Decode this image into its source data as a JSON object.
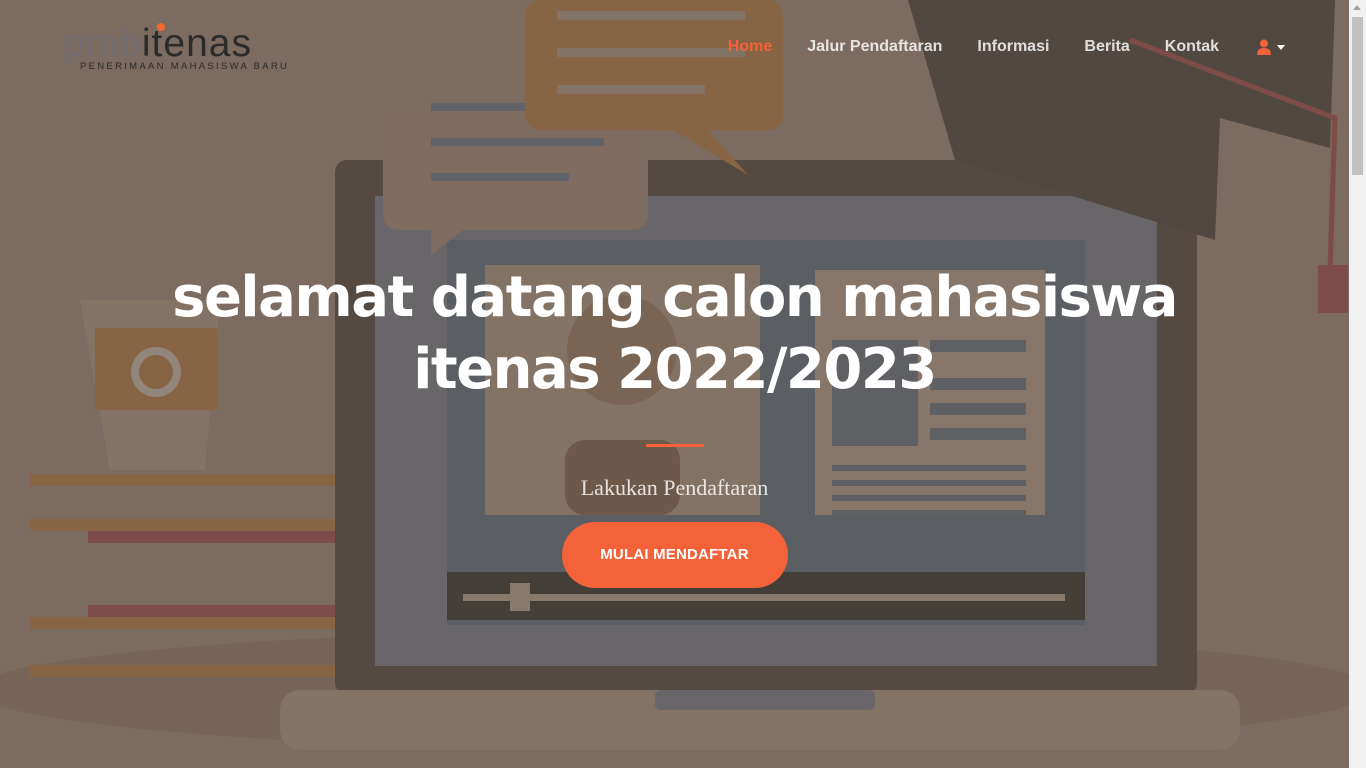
{
  "colors": {
    "accent": "#f4623a",
    "logo_dot": "#f26b2b",
    "overlay": "#7b6a60"
  },
  "logo": {
    "pmb": "pmb",
    "itenas": "itenas",
    "tagline": "PENERIMAAN MAHASISWA BARU"
  },
  "nav": {
    "items": [
      {
        "label": "Home",
        "active": true
      },
      {
        "label": "Jalur Pendaftaran",
        "active": false
      },
      {
        "label": "Informasi",
        "active": false
      },
      {
        "label": "Berita",
        "active": false
      },
      {
        "label": "Kontak",
        "active": false
      }
    ],
    "user_icon": "user-icon",
    "user_menu_caret": "caret-down-icon"
  },
  "hero": {
    "headline": "selamat datang calon mahasiswa itenas 2022/2023",
    "subtitle": "Lakukan Pendaftaran",
    "cta_label": "MULAI MENDAFTAR"
  }
}
